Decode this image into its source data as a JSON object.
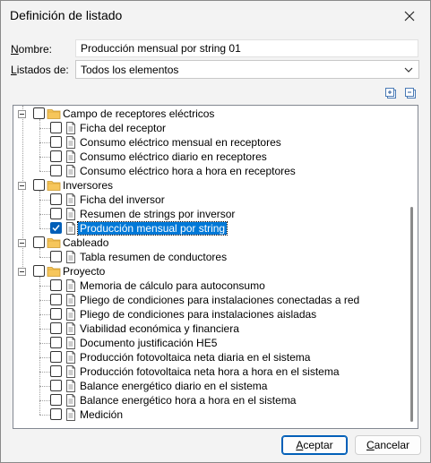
{
  "window": {
    "title": "Definición de listado"
  },
  "form": {
    "nombre_label": "Nombre:",
    "nombre_value": "Producción mensual por string 01",
    "listados_label": "Listados de:",
    "listados_value": "Todos los elementos"
  },
  "tree": {
    "groups": [
      {
        "label": "Campo de receptores eléctricos",
        "items": [
          "Ficha del receptor",
          "Consumo eléctrico mensual en receptores",
          "Consumo eléctrico diario en receptores",
          "Consumo eléctrico hora a hora en receptores"
        ]
      },
      {
        "label": "Inversores",
        "items": [
          "Ficha del inversor",
          "Resumen de strings por inversor",
          "Producción mensual por string"
        ]
      },
      {
        "label": "Cableado",
        "items": [
          "Tabla resumen de conductores"
        ]
      },
      {
        "label": "Proyecto",
        "items": [
          "Memoria de cálculo para autoconsumo",
          "Pliego de condiciones para instalaciones conectadas a red",
          "Pliego de condiciones para instalaciones aisladas",
          "Viabilidad económica y financiera",
          "Documento justificación HE5",
          "Producción fotovoltaica neta diaria en el sistema",
          "Producción fotovoltaica neta hora a hora en el sistema",
          "Balance energético diario en el sistema",
          "Balance energético hora a hora en el sistema",
          "Medición"
        ]
      }
    ],
    "checked_item": "Producción mensual por string"
  },
  "buttons": {
    "accept": "Aceptar",
    "cancel": "Cancelar"
  },
  "colors": {
    "accent": "#005fb8",
    "selection": "#0078d7",
    "folder": "#f6c65b"
  }
}
